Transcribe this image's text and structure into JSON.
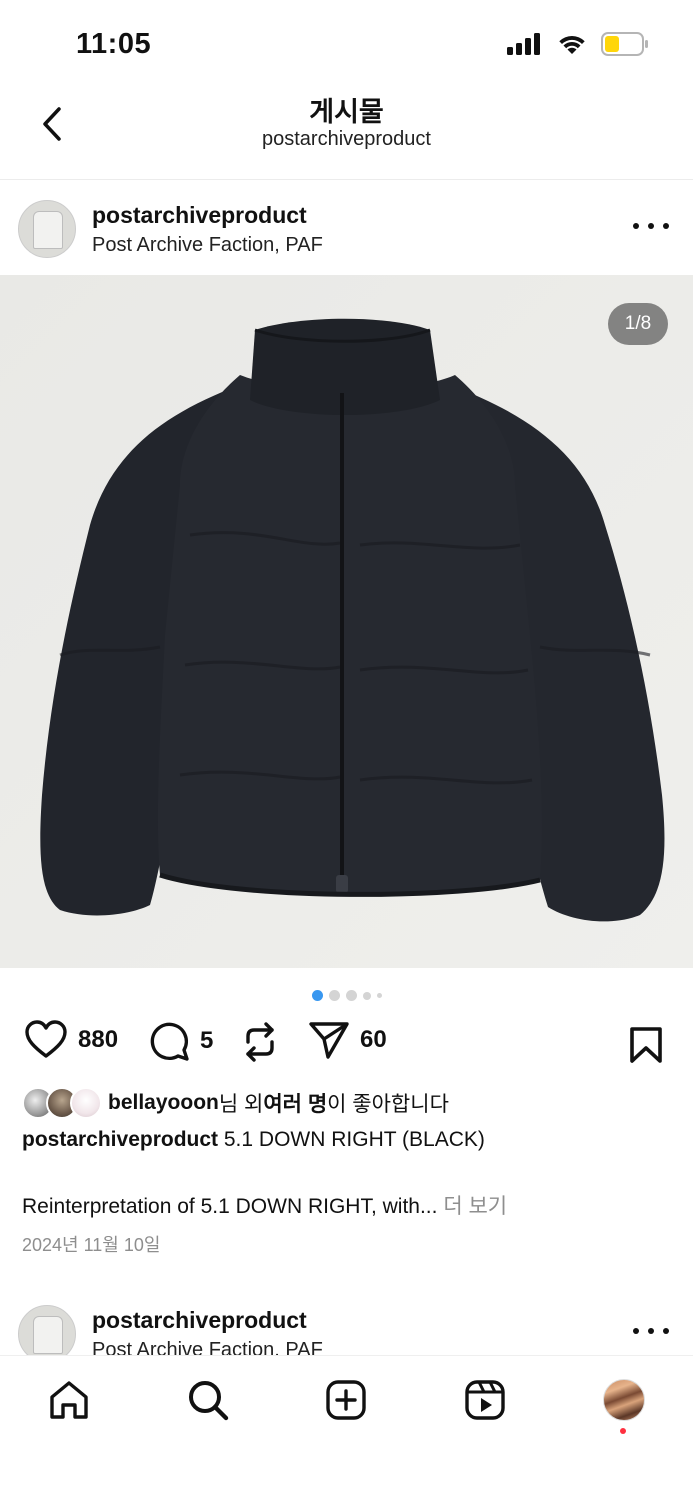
{
  "status": {
    "time": "11:05"
  },
  "nav": {
    "title": "게시물",
    "subtitle": "postarchiveproduct"
  },
  "post": {
    "username": "postarchiveproduct",
    "location": "Post Archive Faction, PAF",
    "media_counter": "1/8",
    "slide_count": 8,
    "active_slide": 1,
    "likes": "880",
    "comments": "5",
    "shares": "60",
    "liked_by": {
      "user": "bellayooon",
      "suffix_1": "님 외 ",
      "others": "여러 명",
      "suffix_2": "이 좋아합니다"
    },
    "caption_user": "postarchiveproduct",
    "caption_text": " 5.1 DOWN RIGHT (BLACK)",
    "description": "Reinterpretation of 5.1 DOWN RIGHT, with... ",
    "more_label": "더 보기",
    "date": "2024년 11월 10일"
  },
  "next_post": {
    "username": "postarchiveproduct",
    "location": "Post Archive Faction, PAF"
  },
  "tabs": [
    "home-icon",
    "search-icon",
    "create-icon",
    "reels-icon",
    "profile-avatar"
  ],
  "colors": {
    "accent_dot": "#3897f0",
    "notification": "#ff3040",
    "battery": "#ffd60a"
  }
}
